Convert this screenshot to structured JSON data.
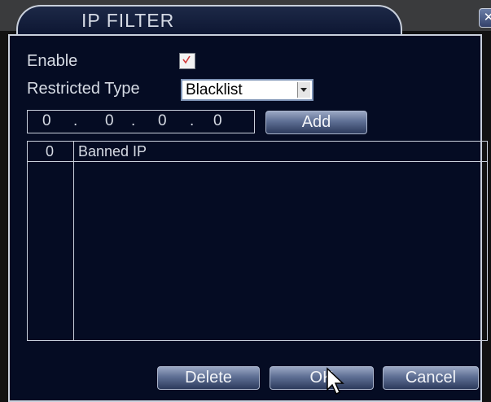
{
  "window": {
    "title": "IP FILTER",
    "close_glyph": "✕"
  },
  "form": {
    "enable_label": "Enable",
    "enable_checked": true,
    "restricted_type_label": "Restricted Type",
    "restricted_type_value": "Blacklist",
    "ip": [
      "0",
      "0",
      "0",
      "0"
    ],
    "ip_separator": ".",
    "add_label": "Add"
  },
  "list": {
    "columns": [
      "0",
      "Banned IP"
    ],
    "rows": []
  },
  "buttons": {
    "delete": "Delete",
    "ok": "OK",
    "cancel": "Cancel"
  },
  "colors": {
    "panel_bg": "#050c23",
    "border": "#c9d0dc",
    "check_mark": "#d23a3a"
  },
  "icons": {
    "close": "close-icon",
    "check": "check-icon",
    "dropdown": "chevron-down-icon",
    "pointer": "mouse-pointer-icon"
  }
}
